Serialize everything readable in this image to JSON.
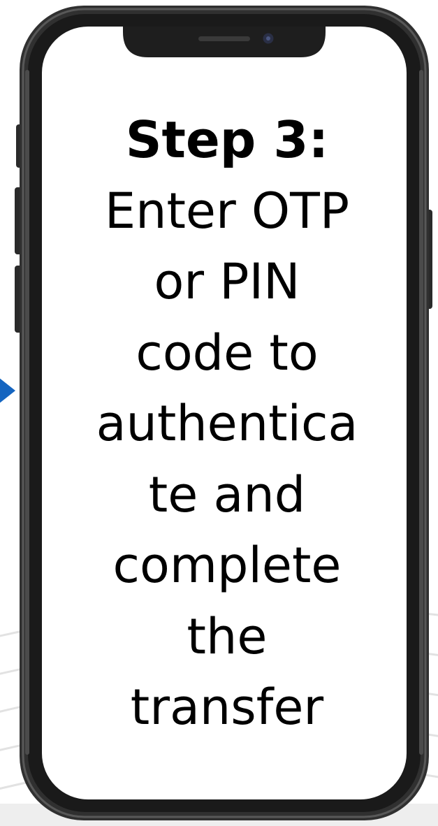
{
  "step": {
    "heading": "Step 3:",
    "lines": [
      "Enter OTP",
      "or PIN",
      "code to",
      "authentica",
      "te and",
      "complete",
      "the",
      "transfer"
    ]
  },
  "colors": {
    "frame": "#2b2b2b",
    "frame_edge": "#4a4a4a",
    "screen": "#ffffff",
    "text": "#000000",
    "arrow": "#1565c0",
    "bg_lines": "#e4e4e4"
  },
  "icons": {
    "camera": "front-camera-icon",
    "speaker": "speaker-grille-icon",
    "arrow": "chevron-right-icon"
  }
}
